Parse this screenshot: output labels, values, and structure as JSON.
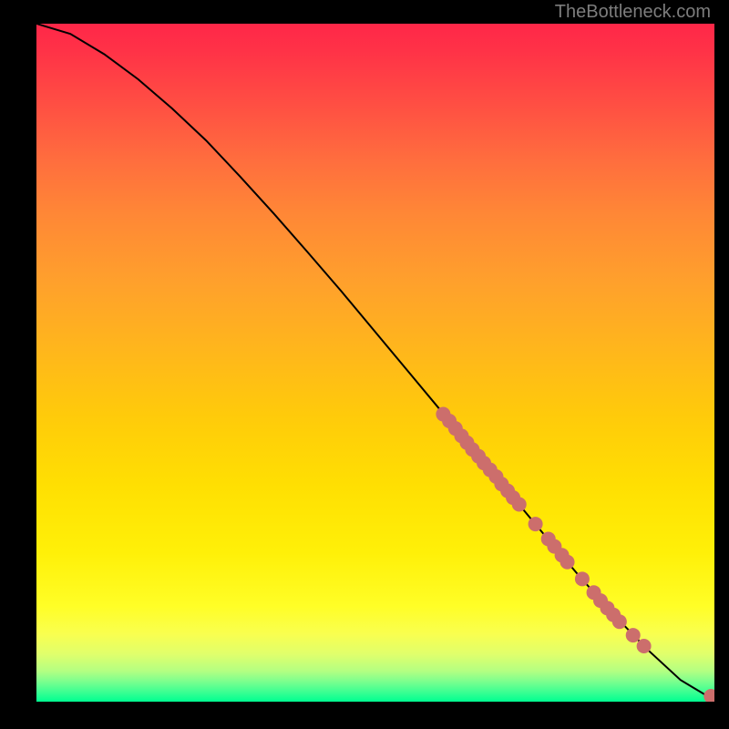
{
  "attribution": "TheBottleneck.com",
  "colors": {
    "page_bg": "#000000",
    "curve": "#000000",
    "point_fill": "#cc6e6c",
    "attribution_text": "#7d7d7d"
  },
  "chart_data": {
    "type": "line",
    "title": "",
    "xlabel": "",
    "ylabel": "",
    "xlim": [
      0,
      100
    ],
    "ylim": [
      0,
      100
    ],
    "curve": {
      "x": [
        0,
        5,
        10,
        15,
        20,
        25,
        30,
        35,
        40,
        45,
        50,
        55,
        60,
        65,
        70,
        75,
        80,
        85,
        90,
        95,
        100
      ],
      "y": [
        100,
        98.5,
        95.5,
        91.8,
        87.5,
        82.8,
        77.5,
        72.0,
        66.3,
        60.5,
        54.5,
        48.5,
        42.5,
        36.5,
        30.5,
        24.5,
        18.6,
        13.0,
        7.8,
        3.2,
        0.2
      ]
    },
    "points": [
      {
        "x": 60.0,
        "y": 42.4
      },
      {
        "x": 60.9,
        "y": 41.4
      },
      {
        "x": 61.8,
        "y": 40.3
      },
      {
        "x": 62.7,
        "y": 39.2
      },
      {
        "x": 63.5,
        "y": 38.2
      },
      {
        "x": 64.3,
        "y": 37.2
      },
      {
        "x": 65.2,
        "y": 36.2
      },
      {
        "x": 66.0,
        "y": 35.2
      },
      {
        "x": 66.9,
        "y": 34.2
      },
      {
        "x": 67.8,
        "y": 33.2
      },
      {
        "x": 68.6,
        "y": 32.1
      },
      {
        "x": 69.5,
        "y": 31.1
      },
      {
        "x": 70.3,
        "y": 30.1
      },
      {
        "x": 71.2,
        "y": 29.1
      },
      {
        "x": 73.6,
        "y": 26.2
      },
      {
        "x": 75.5,
        "y": 24.0
      },
      {
        "x": 76.4,
        "y": 22.9
      },
      {
        "x": 77.5,
        "y": 21.6
      },
      {
        "x": 78.3,
        "y": 20.6
      },
      {
        "x": 80.5,
        "y": 18.1
      },
      {
        "x": 82.2,
        "y": 16.1
      },
      {
        "x": 83.2,
        "y": 14.9
      },
      {
        "x": 84.2,
        "y": 13.8
      },
      {
        "x": 85.1,
        "y": 12.8
      },
      {
        "x": 86.0,
        "y": 11.8
      },
      {
        "x": 88.0,
        "y": 9.8
      },
      {
        "x": 89.6,
        "y": 8.2
      },
      {
        "x": 99.5,
        "y": 0.8
      },
      {
        "x": 100.5,
        "y": 0.4
      }
    ],
    "point_radius": 8
  }
}
